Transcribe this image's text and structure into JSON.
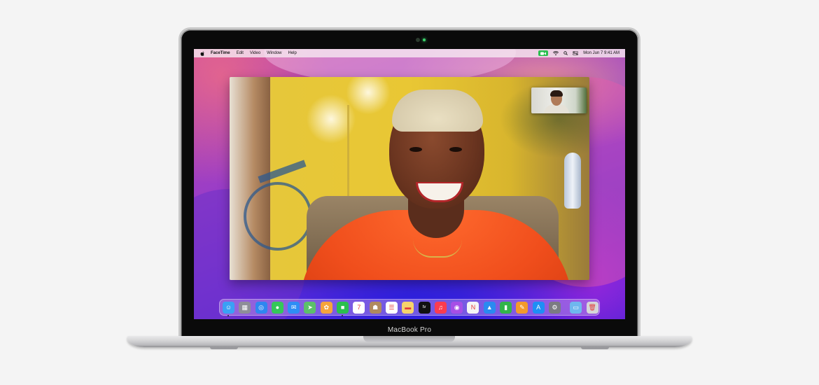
{
  "device": {
    "name_label": "MacBook Pro"
  },
  "menubar": {
    "apple_icon": "apple-logo",
    "items": [
      {
        "label": "FaceTime",
        "bold": true
      },
      {
        "label": "Edit"
      },
      {
        "label": "Video"
      },
      {
        "label": "Window"
      },
      {
        "label": "Help"
      }
    ],
    "status_icons": [
      "facetime-active-icon",
      "wifi-icon",
      "search-icon",
      "control-center-icon"
    ],
    "clock": "Mon Jun 7  9:41 AM"
  },
  "facetime": {
    "main_feed": "remote-participant-video",
    "pip_feed": "self-view-video"
  },
  "dock": {
    "apps": [
      {
        "name": "finder",
        "icon": "finder-icon",
        "color": "#3aa0f5",
        "glyph": "☺",
        "running": true
      },
      {
        "name": "launchpad",
        "icon": "launchpad-icon",
        "color": "#8e8e98",
        "glyph": "▦",
        "running": false
      },
      {
        "name": "safari",
        "icon": "safari-icon",
        "color": "#2f86f0",
        "glyph": "◎",
        "running": false
      },
      {
        "name": "messages",
        "icon": "messages-icon",
        "color": "#34c759",
        "glyph": "●",
        "running": false
      },
      {
        "name": "mail",
        "icon": "mail-icon",
        "color": "#2f8df5",
        "glyph": "✉",
        "running": false
      },
      {
        "name": "maps",
        "icon": "maps-icon",
        "color": "#5cc06a",
        "glyph": "➤",
        "running": false
      },
      {
        "name": "photos",
        "icon": "photos-icon",
        "color": "#f6a33b",
        "glyph": "✿",
        "running": false
      },
      {
        "name": "facetime",
        "icon": "facetime-icon",
        "color": "#2bbf4f",
        "glyph": "■",
        "running": true
      },
      {
        "name": "calendar",
        "icon": "calendar-icon",
        "color": "#ffffff",
        "glyph": "7",
        "running": false
      },
      {
        "name": "contacts",
        "icon": "contacts-icon",
        "color": "#b08a5e",
        "glyph": "☗",
        "running": false
      },
      {
        "name": "reminders",
        "icon": "reminders-icon",
        "color": "#ffffff",
        "glyph": "☰",
        "running": false
      },
      {
        "name": "notes",
        "icon": "notes-icon",
        "color": "#f6d36b",
        "glyph": "▬",
        "running": false
      },
      {
        "name": "tv",
        "icon": "apple-tv-icon",
        "color": "#111111",
        "glyph": "tv",
        "running": false
      },
      {
        "name": "music",
        "icon": "music-icon",
        "color": "#fa3c50",
        "glyph": "♫",
        "running": false
      },
      {
        "name": "podcasts",
        "icon": "podcasts-icon",
        "color": "#a64ee6",
        "glyph": "◉",
        "running": false
      },
      {
        "name": "news",
        "icon": "news-icon",
        "color": "#f5f5f5",
        "glyph": "N",
        "running": false
      },
      {
        "name": "keynote",
        "icon": "keynote-icon",
        "color": "#2a8af0",
        "glyph": "▲",
        "running": false
      },
      {
        "name": "numbers",
        "icon": "numbers-icon",
        "color": "#32b44a",
        "glyph": "▮",
        "running": false
      },
      {
        "name": "pages",
        "icon": "pages-icon",
        "color": "#f39a2c",
        "glyph": "✎",
        "running": false
      },
      {
        "name": "app-store",
        "icon": "app-store-icon",
        "color": "#1e8ef5",
        "glyph": "A",
        "running": false
      },
      {
        "name": "system-preferences",
        "icon": "system-preferences-icon",
        "color": "#7b7b82",
        "glyph": "⚙",
        "running": false
      }
    ],
    "trailing": [
      {
        "name": "downloads",
        "icon": "downloads-folder-icon",
        "color": "#6fb7ee",
        "glyph": "▭"
      },
      {
        "name": "trash",
        "icon": "trash-icon",
        "color": "#d6d6d8",
        "glyph": "🗑"
      }
    ]
  }
}
